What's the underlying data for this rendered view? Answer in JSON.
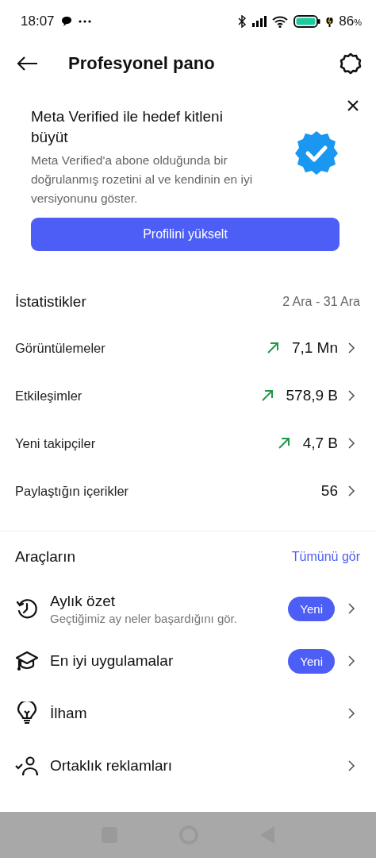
{
  "status_bar": {
    "time": "18:07",
    "battery_percent": "86",
    "percent_sign": "%"
  },
  "header": {
    "title": "Profesyonel pano"
  },
  "promo": {
    "title": "Meta Verified ile hedef kitleni büyüt",
    "body": "Meta Verified'a abone olduğunda bir doğrulanmış rozetini al ve kendinin en iyi versiyonunu göster.",
    "button": "Profilini yükselt"
  },
  "stats": {
    "title": "İstatistikler",
    "date_range": "2 Ara - 31 Ara",
    "rows": [
      {
        "label": "Görüntülemeler",
        "value": "7,1 Mn",
        "trending_up": true
      },
      {
        "label": "Etkileşimler",
        "value": "578,9 B",
        "trending_up": true
      },
      {
        "label": "Yeni takipçiler",
        "value": "4,7 B",
        "trending_up": true
      },
      {
        "label": "Paylaştığın içerikler",
        "value": "56",
        "trending_up": false
      }
    ]
  },
  "tools": {
    "title": "Araçların",
    "see_all": "Tümünü gör",
    "items": [
      {
        "kind": "history",
        "label": "Aylık özet",
        "subtitle": "Geçtiğimiz ay neler başardığını gör.",
        "badge": "Yeni"
      },
      {
        "kind": "graduation",
        "label": "En iyi uygulamalar",
        "badge": "Yeni"
      },
      {
        "kind": "bulb",
        "label": "İlham"
      },
      {
        "kind": "person-check",
        "label": "Ortaklık reklamları"
      }
    ]
  }
}
